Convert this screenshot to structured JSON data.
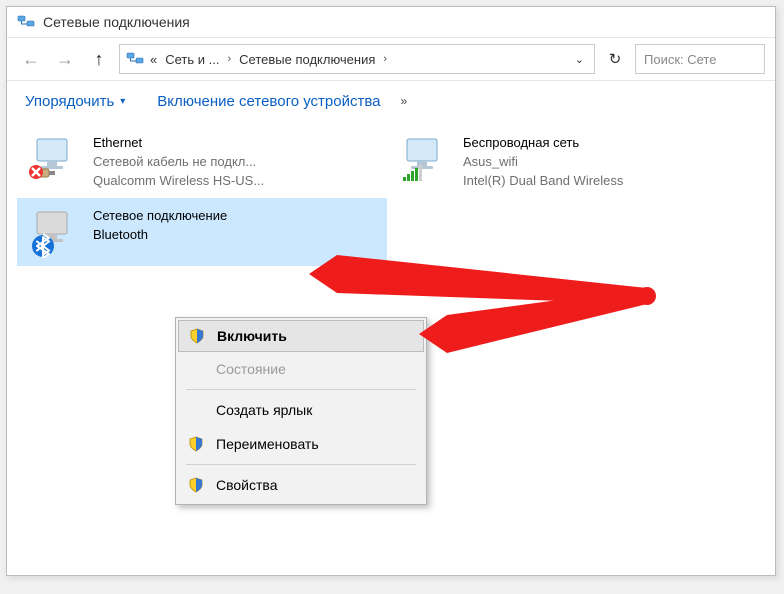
{
  "window": {
    "title": "Сетевые подключения"
  },
  "breadcrumb": {
    "ellipsis": "«",
    "parent": "Сеть и ...",
    "current": "Сетевые подключения"
  },
  "search": {
    "placeholder": "Поиск: Сете"
  },
  "toolbar": {
    "organize": "Упорядочить",
    "command": "Включение сетевого устройства",
    "more": "»"
  },
  "items": [
    {
      "name": "Ethernet",
      "status": "Сетевой кабель не подкл...",
      "device": "Qualcomm Wireless HS-US..."
    },
    {
      "name": "Беспроводная сеть",
      "status": "Asus_wifi",
      "device": "Intel(R) Dual Band Wireless"
    },
    {
      "name": "Сетевое подключение Bluetooth",
      "name_line1": "Сетевое подключение",
      "name_line2": "Bluetooth"
    }
  ],
  "menu": {
    "enable": "Включить",
    "status": "Состояние",
    "shortcut": "Создать ярлык",
    "rename": "Переименовать",
    "properties": "Свойства"
  }
}
